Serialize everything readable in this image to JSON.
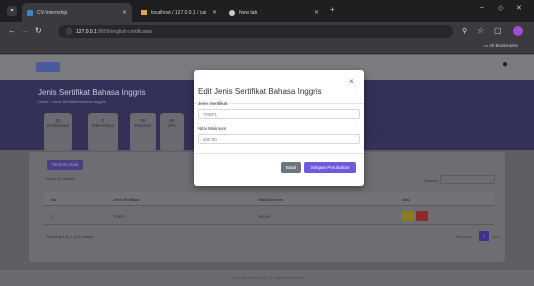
{
  "browser": {
    "tabs": [
      {
        "label": "CV-Internship"
      },
      {
        "label": "localhost / 127.0.0.1 / cai-intern"
      },
      {
        "label": "New tab"
      }
    ],
    "url_host": "127.0.0.1",
    "url_path": ":8000/english-certificates",
    "bookmarks_label": "All Bookmarks"
  },
  "page": {
    "title": "Jenis Sertifikat Bahasa Inggris",
    "breadcrumb": "Home / Jenis Sertifikat Bahasa Inggris",
    "stats": [
      {
        "value": "10",
        "label": "Dashboard"
      },
      {
        "value": "0",
        "label": "Internships"
      },
      {
        "value": "58",
        "label": "Pelamar"
      },
      {
        "value": "56",
        "label": "CPL"
      }
    ],
    "stats_right_label": "Magang",
    "add_button": "Tambah Data",
    "show_entries": "Show 10 entries",
    "search_label": "Search:",
    "table": {
      "headers": [
        "No",
        "Jenis Sertifikat",
        "Nilai Minimum",
        "Aksi"
      ],
      "rows": [
        [
          "1",
          "TOEFL",
          "400.00",
          ""
        ]
      ]
    },
    "showing": "Showing 1 to 1 of 1 entries",
    "pagination": {
      "prev": "Previous",
      "current": "1",
      "next": "Next"
    },
    "footer": "Copyright Stemba IT. All Rights Reserved"
  },
  "modal": {
    "title": "Edit Jenis Sertifikat Bahasa Inggris",
    "field1_label": "Jenis Sertifikat",
    "field1_value": "TOEFL",
    "field2_label": "Nilai Minimum",
    "field2_value": "400.00",
    "cancel": "Batal",
    "save": "Simpan Perubahan"
  },
  "colors": {
    "accent": "#6f5ad9",
    "hero": "#343158"
  }
}
